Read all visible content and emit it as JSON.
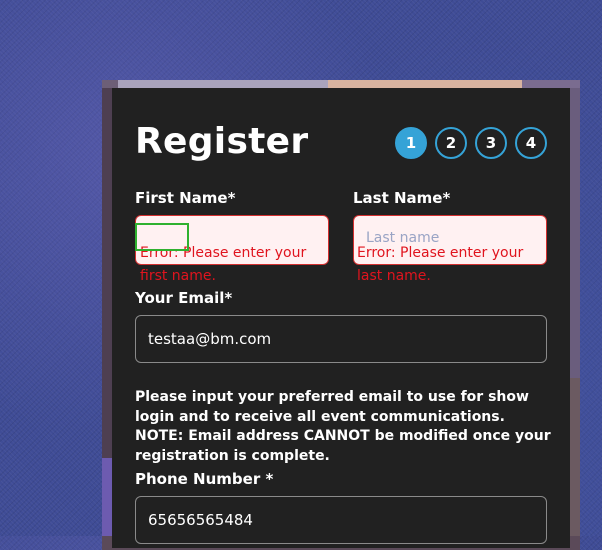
{
  "form": {
    "title": "Register",
    "steps": [
      "1",
      "2",
      "3",
      "4"
    ],
    "active_step": 1,
    "first_name": {
      "label": "First Name*",
      "value": "",
      "placeholder": "",
      "error": "Error: Please enter your first name."
    },
    "last_name": {
      "label": "Last Name*",
      "value": "",
      "placeholder": "Last name",
      "error": "Error: Please enter your last name."
    },
    "email": {
      "label": "Your Email*",
      "value": "testaa@bm.com"
    },
    "email_hint": "Please input your preferred email to use for show login and to receive all event communications. NOTE: Email address CANNOT be modified once your registration is complete.",
    "phone": {
      "label": "Phone Number *",
      "value": "65656565484"
    }
  },
  "colors": {
    "accent": "#35a3d7",
    "error": "#e0141e",
    "card_bg": "#212121"
  }
}
